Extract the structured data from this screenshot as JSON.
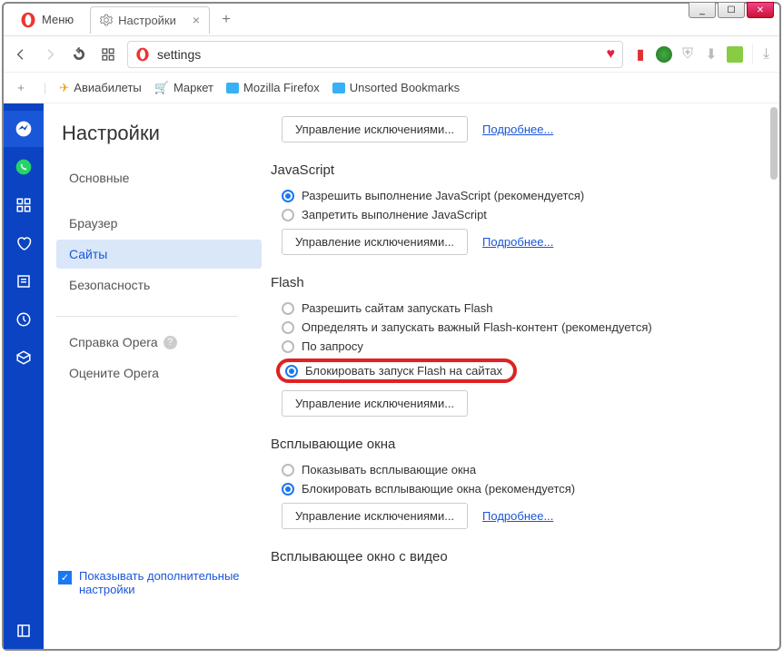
{
  "titlebar": {
    "min": "_",
    "max": "☐",
    "close": "✕"
  },
  "menu_label": "Меню",
  "tab": {
    "title": "Настройки"
  },
  "url": "settings",
  "bookmarks": {
    "flights": "Авиабилеты",
    "market": "Маркет",
    "firefox": "Mozilla Firefox",
    "unsorted": "Unsorted Bookmarks"
  },
  "sidebar": {
    "title": "Настройки",
    "items": [
      "Основные",
      "Браузер",
      "Сайты",
      "Безопасность"
    ],
    "help": "Справка Opera",
    "rate": "Оцените Opera",
    "show_adv": "Показывать дополнительные настройки"
  },
  "settings": {
    "manage_exceptions": "Управление исключениями...",
    "more": "Подробнее...",
    "js_header": "JavaScript",
    "js_allow": "Разрешить выполнение JavaScript (рекомендуется)",
    "js_block": "Запретить выполнение JavaScript",
    "flash_header": "Flash",
    "flash_allow": "Разрешить сайтам запускать Flash",
    "flash_detect": "Определять и запускать важный Flash-контент (рекомендуется)",
    "flash_ask": "По запросу",
    "flash_block": "Блокировать запуск Flash на сайтах",
    "popup_header": "Всплывающие окна",
    "popup_show": "Показывать всплывающие окна",
    "popup_block": "Блокировать всплывающие окна (рекомендуется)",
    "video_header": "Всплывающее окно с видео"
  }
}
